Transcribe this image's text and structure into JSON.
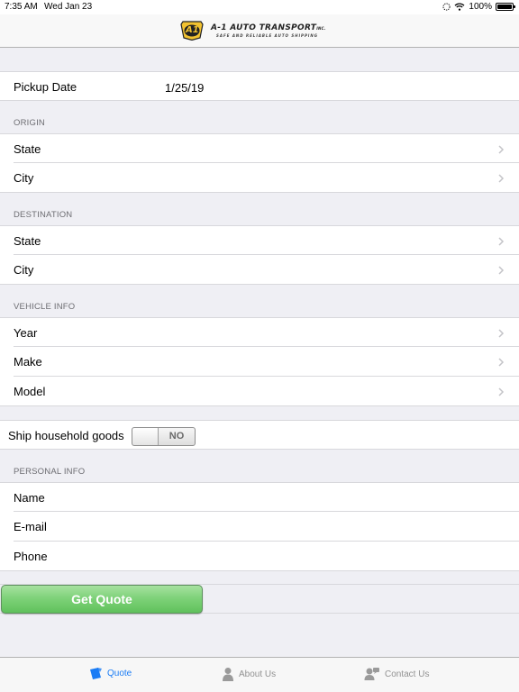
{
  "status_bar": {
    "time": "7:35 AM",
    "date": "Wed Jan 23",
    "battery": "100%"
  },
  "header": {
    "logo_badge": "A1",
    "logo_title": "A-1 AUTO TRANSPORT",
    "logo_inc": "INC.",
    "logo_tagline": "SAFE AND RELIABLE AUTO SHIPPING"
  },
  "pickup": {
    "label": "Pickup Date",
    "value": "1/25/19"
  },
  "origin": {
    "header": "ORIGIN",
    "state_label": "State",
    "city_label": "City"
  },
  "destination": {
    "header": "DESTINATION",
    "state_label": "State",
    "city_label": "City"
  },
  "vehicle": {
    "header": "VEHICLE INFO",
    "year_label": "Year",
    "make_label": "Make",
    "model_label": "Model"
  },
  "household": {
    "label": "Ship household goods",
    "toggle_text": "NO"
  },
  "personal": {
    "header": "PERSONAL INFO",
    "name_label": "Name",
    "email_label": "E-mail",
    "phone_label": "Phone"
  },
  "actions": {
    "get_quote_label": "Get Quote"
  },
  "tabs": [
    {
      "label": "Quote",
      "icon": "quote-icon"
    },
    {
      "label": "About Us",
      "icon": "person-icon"
    },
    {
      "label": "Contact Us",
      "icon": "contact-icon"
    }
  ],
  "colors": {
    "accent": "#1a7cf5",
    "button_green": "#7fd27a",
    "background": "#efeff4"
  }
}
